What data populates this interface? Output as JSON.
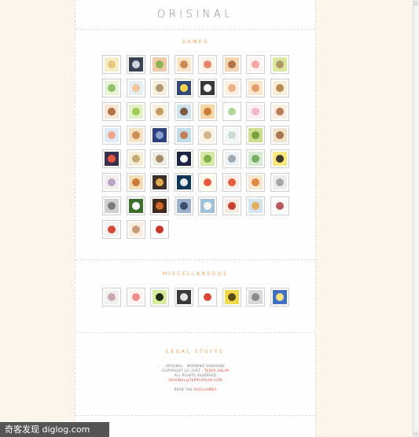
{
  "site": {
    "logo": "ORISINAL"
  },
  "sections": {
    "games": {
      "title": "GAMES"
    },
    "misc": {
      "title": "MISCELLANEOUS"
    },
    "legal": {
      "title": "LEGAL STUFFS"
    }
  },
  "legal_lines": {
    "line1": "ORISINAL : MORNING SUNSHINE",
    "line2_prefix": "COPYRIGHT (C) 2007 - ",
    "line2_author": "TERRY HALIM",
    "line3": "ALL RIGHTS RESERVED",
    "line4": "ORISINAL@TERRYHALIM.COM",
    "line5_prefix": "READ THE ",
    "line5_link": "DISCLAIMER"
  },
  "watermark": {
    "text": "奇客发现 diglog.com"
  },
  "game_icons": [
    [
      "sun-rays-icon",
      "#f6ecc8",
      "#e7c77d"
    ],
    [
      "bell-icon",
      "#3a4356",
      "#cfd6e0"
    ],
    [
      "orange-pot-icon",
      "#f2c9a6",
      "#8ab356"
    ],
    [
      "teddy-bear-icon",
      "#fde3c8",
      "#c98a55"
    ],
    [
      "pink-card-icon",
      "#fbf3e8",
      "#e4866e"
    ],
    [
      "monkey-icon",
      "#f4d6b3",
      "#b07345"
    ],
    [
      "pink-flower-icon",
      "#fff3f1",
      "#f4a6a6"
    ],
    [
      "bunny-icon",
      "#dce7a0",
      "#b09865"
    ],
    [
      "snail-icon",
      "#e9f3d6",
      "#8fc06a"
    ],
    [
      "cherub-icon",
      "#e5eef3",
      "#f1c69d"
    ],
    [
      "white-bird-icon",
      "#f7eed9",
      "#ad9876"
    ],
    [
      "star-icon",
      "#2f4b7a",
      "#f4d54d"
    ],
    [
      "cat-icon",
      "#3a3a3a",
      "#ffffff"
    ],
    [
      "sleeping-face-icon",
      "#fdf0e3",
      "#e9b38c"
    ],
    [
      "baby-icon",
      "#fde6cc",
      "#e49d6d"
    ],
    [
      "deer-icon",
      "#f7edd8",
      "#b88b4f"
    ],
    [
      "kid-icon",
      "#f7e7d2",
      "#b47049"
    ],
    [
      "green-ball-icon",
      "#e5f1c6",
      "#9dcc57"
    ],
    [
      "potato-icon",
      "#f6f0df",
      "#c49c63"
    ],
    [
      "dog-icon",
      "#cfe3ef",
      "#7a5b3f"
    ],
    [
      "lion-icon",
      "#f6d7a5",
      "#ca7c3b"
    ],
    [
      "leaf-icon",
      "#ffffff",
      "#b2d79c"
    ],
    [
      "piglet-icon",
      "#fbeff2",
      "#efb7c3"
    ],
    [
      "girl-icon",
      "#fbefe2",
      "#b77e58"
    ],
    [
      "pink-sun-icon",
      "#dcebf5",
      "#f2a58d"
    ],
    [
      "fox-icon",
      "#f5e2c2",
      "#c99155"
    ],
    [
      "blue-monster-icon",
      "#2d3f7d",
      "#8b9fce"
    ],
    [
      "bear-on-ball-icon",
      "#c3dcec",
      "#c17e58"
    ],
    [
      "feather-icon",
      "#fbf3e6",
      "#d6b28d"
    ],
    [
      "ghost-icon",
      "#f3f8f6",
      "#c8dccf"
    ],
    [
      "lime-icon",
      "#ccdf8f",
      "#7ba240"
    ],
    [
      "deer-run-icon",
      "#f2e2cc",
      "#a7764d"
    ],
    [
      "tetris-blocks-icon",
      "#3a2f4f",
      "#e8533e"
    ],
    [
      "dove-icon",
      "#f6edd7",
      "#c3ac72"
    ],
    [
      "cartoon-deer-icon",
      "#f0ede4",
      "#a58c6a"
    ],
    [
      "moon-icon",
      "#1d2340",
      "#ffffff"
    ],
    [
      "green-frog-icon",
      "#d6e8a6",
      "#7eae47"
    ],
    [
      "koala-icon",
      "#eef2f5",
      "#9da8b1"
    ],
    [
      "green-plant-icon",
      "#d7ebd2",
      "#78ad63"
    ],
    [
      "bee-icon",
      "#f9e67d",
      "#3b3b2b"
    ],
    [
      "bell-girl-icon",
      "#f2eef0",
      "#b8a6c1"
    ],
    [
      "tiger-icon",
      "#f2ddb6",
      "#c87b36"
    ],
    [
      "spider-icon",
      "#3b2f27",
      "#e1a84d"
    ],
    [
      "hare-icon",
      "#0f3657",
      "#e8eef3"
    ],
    [
      "game-sign-icon",
      "#fffbeb",
      "#e55d3f"
    ],
    [
      "crab-icon",
      "#fcefe7",
      "#e55d45"
    ],
    [
      "mushroom-icon",
      "#f8e6cd",
      "#e08848"
    ],
    [
      "elephant-icon",
      "#ececec",
      "#a7a7a7"
    ],
    [
      "gear-disc-icon",
      "#d0d0d0",
      "#7c7c7c"
    ],
    [
      "cow-icon",
      "#3d6f2f",
      "#ffffff"
    ],
    [
      "pumpkin-icon",
      "#3f2a1d",
      "#d0682f"
    ],
    [
      "wolf-icon",
      "#9fb0cc",
      "#3e4f73"
    ],
    [
      "pelican-icon",
      "#9ec1d9",
      "#fbf7f2"
    ],
    [
      "magnet-icon",
      "#f4ebe2",
      "#c8412f"
    ],
    [
      "boat-icon",
      "#d3e4ef",
      "#e7ae5f"
    ],
    [
      "thermometer-icon",
      "#fafafa",
      "#b85a5a"
    ],
    [
      "snowman-icon",
      "#f2f2f2",
      "#d54b3a"
    ],
    [
      "sleepy-child-icon",
      "#fbede0",
      "#c79a77"
    ],
    [
      "red-apple-icon",
      "#ffffff",
      "#c9352b"
    ]
  ],
  "misc_icons": [
    [
      "teapot-icon",
      "#f3f0f0",
      "#c9a9ab"
    ],
    [
      "pink-heart-icon",
      "#fff3f1",
      "#ee8d8d"
    ],
    [
      "green-alien-icon",
      "#d7ee9f",
      "#1e2a12"
    ],
    [
      "dancer-icon",
      "#3a3a3a",
      "#e3e3e3"
    ],
    [
      "stop-sign-icon",
      "#ffffff",
      "#e0453a"
    ],
    [
      "yellow-sign-icon",
      "#f1d84c",
      "#5c4e12"
    ],
    [
      "car-icon",
      "#d8d8d8",
      "#8a8a8a"
    ],
    [
      "blue-stars-icon",
      "#3f6fc6",
      "#f7e07a"
    ]
  ]
}
